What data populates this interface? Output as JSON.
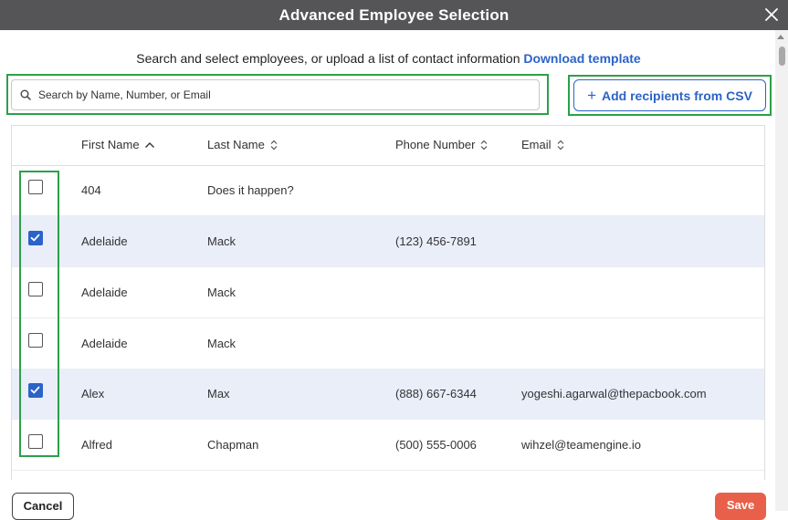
{
  "dialog": {
    "title": "Advanced Employee Selection",
    "intro_text": "Search and select employees, or upload a list of contact information",
    "download_template_label": "Download template"
  },
  "search": {
    "placeholder": "Search by Name, Number, or Email",
    "value": ""
  },
  "csv_button": {
    "icon": "plus-icon",
    "label": "Add recipients from CSV"
  },
  "table": {
    "columns": [
      {
        "label": "First Name",
        "sort": "ascending"
      },
      {
        "label": "Last Name",
        "sort": "none"
      },
      {
        "label": "Phone Number",
        "sort": "none"
      },
      {
        "label": "Email",
        "sort": "none"
      }
    ],
    "rows": [
      {
        "checked": false,
        "first_name": "404",
        "last_name": "Does it happen?",
        "phone": "",
        "email": ""
      },
      {
        "checked": true,
        "first_name": "Adelaide",
        "last_name": "Mack",
        "phone": "(123) 456-7891",
        "email": ""
      },
      {
        "checked": false,
        "first_name": "Adelaide",
        "last_name": "Mack",
        "phone": "",
        "email": ""
      },
      {
        "checked": false,
        "first_name": "Adelaide",
        "last_name": "Mack",
        "phone": "",
        "email": ""
      },
      {
        "checked": true,
        "first_name": "Alex",
        "last_name": "Max",
        "phone": "(888) 667-6344",
        "email": "yogeshi.agarwal@thepacbook.com"
      },
      {
        "checked": false,
        "first_name": "Alfred",
        "last_name": "Chapman",
        "phone": "(500) 555-0006",
        "email": "wihzel@teamengine.io"
      }
    ]
  },
  "footer": {
    "cancel_label": "Cancel",
    "save_label": "Save"
  },
  "colors": {
    "title_bar": "#555456",
    "accent_blue": "#2b63c8",
    "highlight_green": "#2ca04a",
    "selected_row": "#e9eef9",
    "save_button": "#e8604a"
  }
}
